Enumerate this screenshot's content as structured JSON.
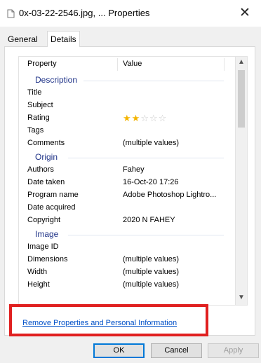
{
  "window": {
    "title": "0x-03-22-2546.jpg, ... Properties",
    "close_glyph": "✕",
    "icon": "file-icon"
  },
  "tabs": [
    {
      "label": "General",
      "active": false
    },
    {
      "label": "Details",
      "active": true
    }
  ],
  "columns": {
    "property": "Property",
    "value": "Value"
  },
  "groups": {
    "description": "Description",
    "origin": "Origin",
    "image": "Image"
  },
  "rows": {
    "title": {
      "name": "Title",
      "value": ""
    },
    "subject": {
      "name": "Subject",
      "value": ""
    },
    "rating": {
      "name": "Rating",
      "stars": 2,
      "max_stars": 5
    },
    "tags": {
      "name": "Tags",
      "value": ""
    },
    "comments": {
      "name": "Comments",
      "value": "(multiple values)"
    },
    "authors": {
      "name": "Authors",
      "value": "Fahey"
    },
    "date_taken": {
      "name": "Date taken",
      "value": "16-Oct-20 17:26"
    },
    "program_name": {
      "name": "Program name",
      "value": "Adobe Photoshop Lightro..."
    },
    "date_acquired": {
      "name": "Date acquired",
      "value": ""
    },
    "copyright": {
      "name": "Copyright",
      "value": "2020 N FAHEY"
    },
    "image_id": {
      "name": "Image ID",
      "value": ""
    },
    "dimensions": {
      "name": "Dimensions",
      "value": "(multiple values)"
    },
    "width": {
      "name": "Width",
      "value": "(multiple values)"
    },
    "height": {
      "name": "Height",
      "value": "(multiple values)"
    }
  },
  "link": {
    "label": "Remove Properties and Personal Information"
  },
  "buttons": {
    "ok": "OK",
    "cancel": "Cancel",
    "apply": "Apply"
  },
  "colors": {
    "highlight": "#e02020",
    "link": "#0050c8",
    "group_heading": "#1e3287",
    "star": "#f4b400"
  }
}
